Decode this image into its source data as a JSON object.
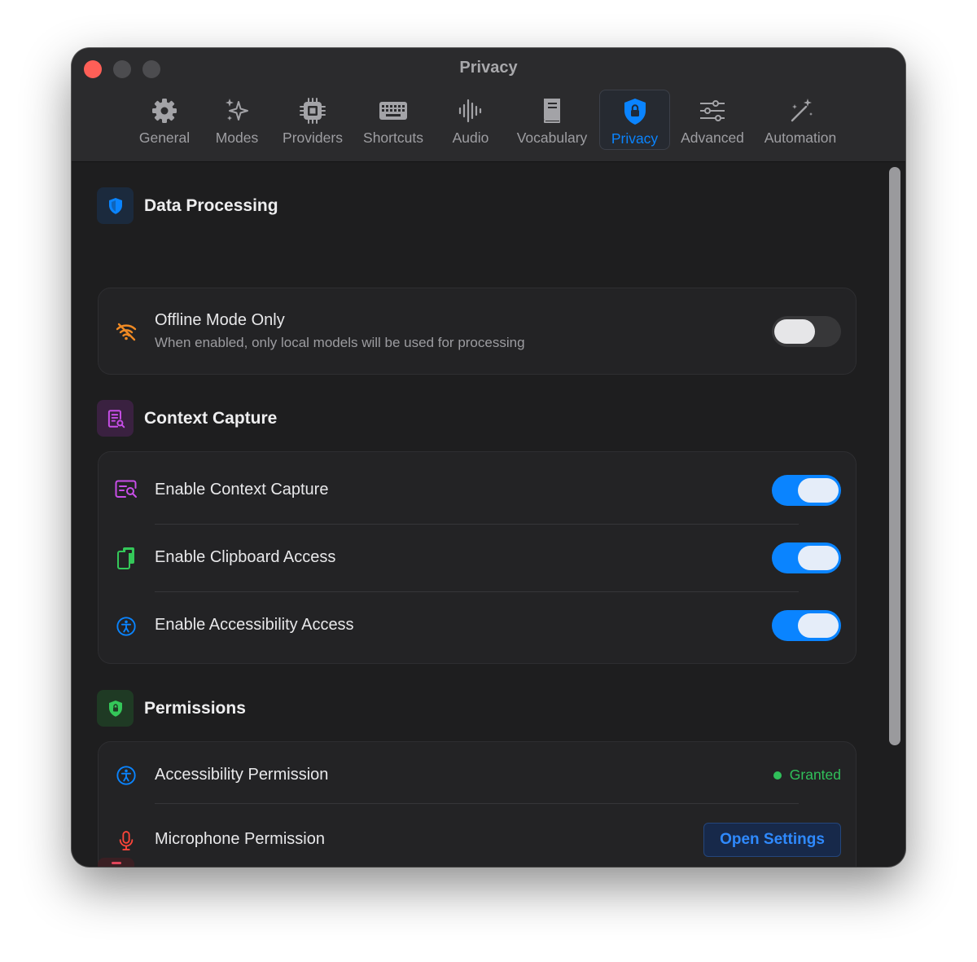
{
  "window": {
    "title": "Privacy"
  },
  "tabs": [
    {
      "label": "General",
      "icon": "gear-icon"
    },
    {
      "label": "Modes",
      "icon": "sparkles-icon"
    },
    {
      "label": "Providers",
      "icon": "cpu-chip-icon"
    },
    {
      "label": "Shortcuts",
      "icon": "keyboard-icon"
    },
    {
      "label": "Audio",
      "icon": "waveform-icon"
    },
    {
      "label": "Vocabulary",
      "icon": "book-icon"
    },
    {
      "label": "Privacy",
      "icon": "shield-lock-icon",
      "active": true
    },
    {
      "label": "Advanced",
      "icon": "sliders-icon"
    },
    {
      "label": "Automation",
      "icon": "magic-wand-icon"
    }
  ],
  "sections": {
    "data_processing": {
      "title": "Data Processing",
      "icon": "shield-icon",
      "offline_mode": {
        "title": "Offline Mode Only",
        "subtitle": "When enabled, only local models will be used for processing",
        "icon": "wifi-slash-icon",
        "enabled": false
      }
    },
    "context_capture": {
      "title": "Context Capture",
      "icon": "document-search-icon",
      "items": [
        {
          "title": "Enable Context Capture",
          "icon": "text-search-icon",
          "enabled": true
        },
        {
          "title": "Enable Clipboard Access",
          "icon": "clipboard-icon",
          "enabled": true
        },
        {
          "title": "Enable Accessibility Access",
          "icon": "accessibility-icon",
          "enabled": true
        }
      ]
    },
    "permissions": {
      "title": "Permissions",
      "icon": "lock-shield-icon",
      "accessibility": {
        "title": "Accessibility Permission",
        "icon": "accessibility-icon",
        "status": "Granted"
      },
      "microphone": {
        "title": "Microphone Permission",
        "icon": "microphone-icon",
        "button": "Open Settings"
      }
    }
  },
  "colors": {
    "accent": "#0a84ff",
    "granted": "#30c05a",
    "window_bg": "#1e1e1f",
    "titlebar_bg": "#2b2b2d",
    "offline_icon": "#f08a24",
    "context_icon": "#c84ee8",
    "clipboard_icon": "#34c759",
    "microphone_icon": "#ff453a"
  }
}
